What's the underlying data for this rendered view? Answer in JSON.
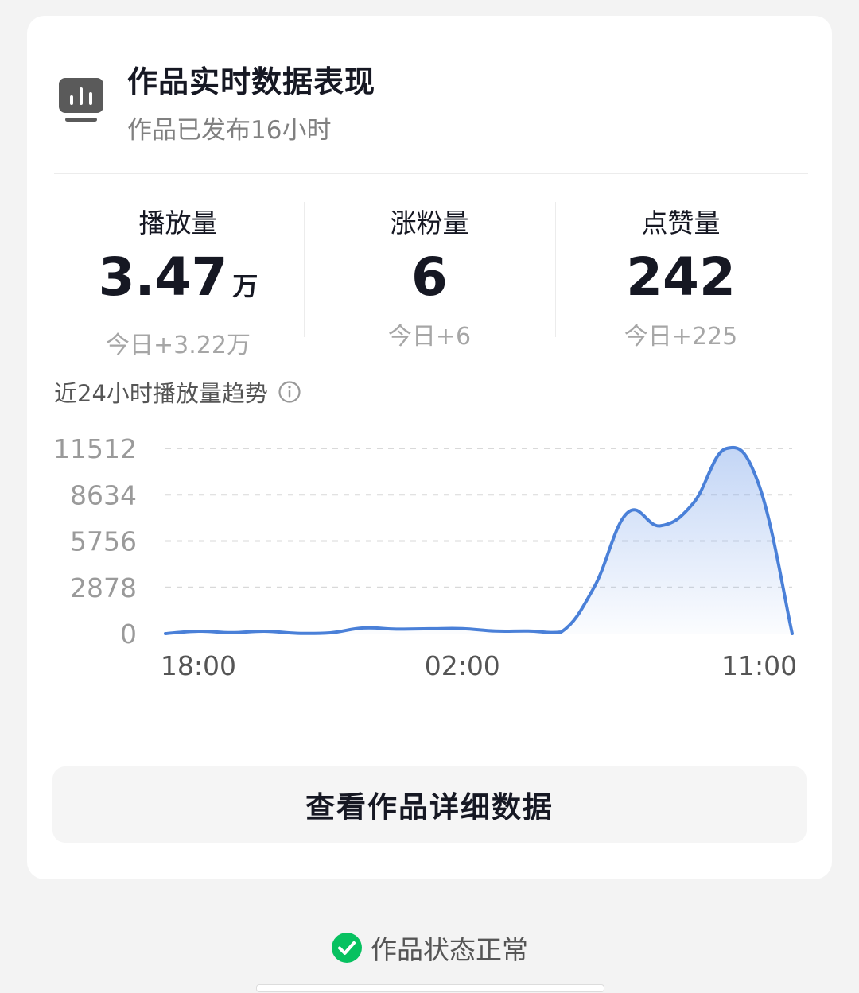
{
  "header": {
    "title": "作品实时数据表现",
    "subtitle": "作品已发布16小时",
    "icon": "bar-chart-icon"
  },
  "stats": [
    {
      "label": "播放量",
      "value": "3.47",
      "unit": "万",
      "delta": "今日+3.22万"
    },
    {
      "label": "涨粉量",
      "value": "6",
      "unit": "",
      "delta": "今日+6"
    },
    {
      "label": "点赞量",
      "value": "242",
      "unit": "",
      "delta": "今日+225"
    }
  ],
  "trend": {
    "title": "近24小时播放量趋势",
    "info_icon": "info-icon"
  },
  "chart_data": {
    "type": "area",
    "x": [
      "17:00",
      "18:00",
      "19:00",
      "20:00",
      "21:00",
      "22:00",
      "23:00",
      "00:00",
      "01:00",
      "02:00",
      "03:00",
      "04:00",
      "05:00",
      "06:00",
      "07:00",
      "08:00",
      "09:00",
      "10:00",
      "11:00",
      "12:00"
    ],
    "values": [
      0,
      150,
      60,
      150,
      20,
      50,
      350,
      280,
      300,
      310,
      160,
      160,
      100,
      2900,
      7500,
      6700,
      8100,
      11500,
      9200,
      0
    ],
    "y_ticks": [
      "0",
      "2878",
      "5756",
      "8634",
      "11512"
    ],
    "x_ticks": [
      "18:00",
      "02:00",
      "11:00"
    ],
    "ylim": [
      0,
      11512
    ],
    "grid": true,
    "color": "#4a80d8"
  },
  "detail_button": {
    "label": "查看作品详细数据"
  },
  "status": {
    "text": "作品状态正常",
    "icon": "check-circle-icon",
    "color": "#07c160"
  }
}
